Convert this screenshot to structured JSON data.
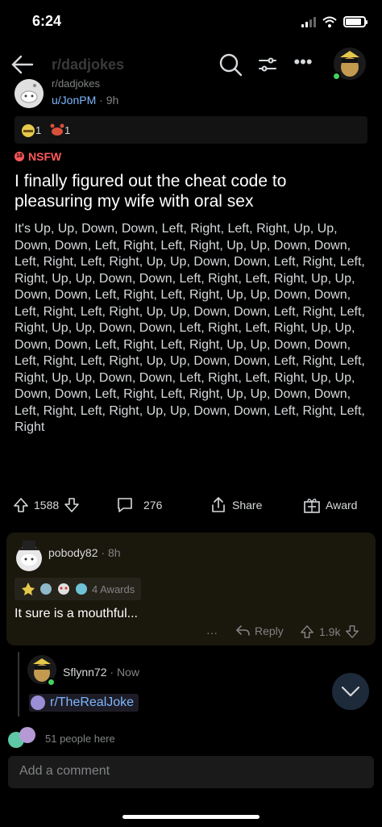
{
  "status_bar": {
    "time": "6:24"
  },
  "nav": {
    "subreddit": "r/dadjokes",
    "icons": [
      "back-arrow-icon",
      "search-icon",
      "sort-icon",
      "more-icon",
      "avatar"
    ]
  },
  "post": {
    "subreddit": "r/dadjokes",
    "author": "u/JonPM",
    "age": "9h",
    "awards": [
      {
        "icon": "award-helmet-icon",
        "count": "1"
      },
      {
        "icon": "award-crab-icon",
        "count": "1"
      }
    ],
    "nsfw_label": "NSFW",
    "title": "I finally figured out the cheat code to pleasuring my wife with oral sex",
    "body": "It's Up, Up, Down, Down, Left, Right, Left, Right, Up, Up, Down, Down, Left, Right, Left, Right, Up, Up, Down, Down, Left, Right, Left, Right, Up, Up, Down, Down, Left, Right, Left, Right, Up, Up, Down, Down, Left, Right, Left, Right, Up, Up, Down, Down, Left, Right, Left, Right, Up, Up, Down, Down, Left, Right, Left, Right, Up, Up, Down, Down, Left, Right, Left, Right, Up, Up, Down, Down, Left, Right, Left, Right, Up, Up, Down, Down, Left, Right, Left, Right, Up, Up, Down, Down, Left, Right, Left, Right, Up, Up, Down, Down, Left, Right, Left, Right, Up, Up, Down, Down, Left, Right, Left, Right, Up, Up, Down, Down, Left, Right, Left, Right, Up, Up, Down, Down, Left, Right, Left, Right, Up, Up, Down, Down, Left, Right, Left, Right",
    "score": "1588",
    "comments": "276",
    "share_label": "Share",
    "award_label": "Award"
  },
  "comment": {
    "author": "pobody82",
    "age": "8h",
    "awards_label": "4 Awards",
    "text": "It sure is a mouthful...",
    "more": "···",
    "reply_label": "Reply",
    "score": "1.9k"
  },
  "reply": {
    "author": "Sflynn72",
    "age": "Now",
    "link": "r/TheRealJoke"
  },
  "footer": {
    "people_here": "51 people here",
    "add_comment_placeholder": "Add a comment"
  },
  "colors": {
    "background": "#000000",
    "link": "#7eb6ff",
    "nsfw": "#ff585b",
    "comment_card": "#1a170c",
    "online": "#46d160"
  }
}
